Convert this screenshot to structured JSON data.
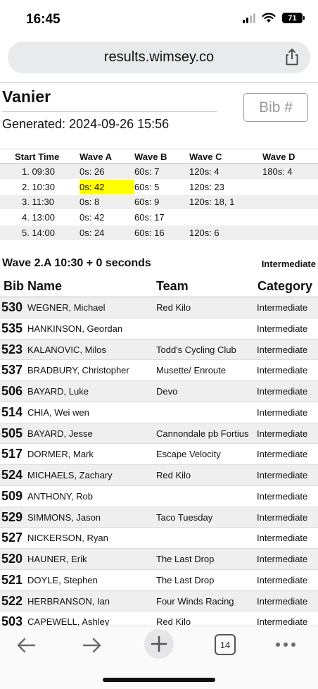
{
  "status_bar": {
    "time": "16:45",
    "battery": "71"
  },
  "browser": {
    "url": "results.wimsey.co",
    "tab_count": "14"
  },
  "page": {
    "title": "Vanier",
    "generated": "Generated: 2024-09-26 15:56",
    "bib_placeholder": "Bib #"
  },
  "wave_table": {
    "headers": [
      "Start Time",
      "Wave A",
      "Wave B",
      "Wave C",
      "Wave D"
    ],
    "rows": [
      [
        "1. 09:30",
        "0s: 26",
        "60s: 7",
        "120s: 4",
        "180s: 4"
      ],
      [
        "2. 10:30",
        "0s: 42",
        "60s: 5",
        "120s: 23",
        ""
      ],
      [
        "3. 11:30",
        "0s: 8",
        "60s: 9",
        "120s: 18, 1",
        ""
      ],
      [
        "4. 13:00",
        "0s: 42",
        "60s: 17",
        "",
        ""
      ],
      [
        "5. 14:00",
        "0s: 24",
        "60s: 16",
        "120s: 6",
        ""
      ]
    ],
    "highlight_color": "#ffff00"
  },
  "wave_section": {
    "heading": "Wave 2.A 10:30 + 0 seconds",
    "category": "Intermediate",
    "headers": {
      "bib": "Bib",
      "name": "Name",
      "team": "Team",
      "category": "Category"
    },
    "riders": [
      {
        "bib": "530",
        "name": "WEGNER, Michael",
        "team": "Red Kilo",
        "category": "Intermediate"
      },
      {
        "bib": "535",
        "name": "HANKINSON, Geordan",
        "team": "",
        "category": "Intermediate"
      },
      {
        "bib": "523",
        "name": "KALANOVIC, Milos",
        "team": "Todd's Cycling Club",
        "category": "Intermediate"
      },
      {
        "bib": "537",
        "name": "BRADBURY, Christopher",
        "team": "Musette/ Enroute",
        "category": "Intermediate"
      },
      {
        "bib": "506",
        "name": "BAYARD, Luke",
        "team": "Devo",
        "category": "Intermediate"
      },
      {
        "bib": "514",
        "name": "CHIA, Wei wen",
        "team": "",
        "category": "Intermediate"
      },
      {
        "bib": "505",
        "name": "BAYARD, Jesse",
        "team": "Cannondale pb Fortius",
        "category": "Intermediate"
      },
      {
        "bib": "517",
        "name": "DORMER, Mark",
        "team": "Escape Velocity",
        "category": "Intermediate"
      },
      {
        "bib": "524",
        "name": "MICHAELS, Zachary",
        "team": "Red Kilo",
        "category": "Intermediate"
      },
      {
        "bib": "509",
        "name": "ANTHONY, Rob",
        "team": "",
        "category": "Intermediate"
      },
      {
        "bib": "529",
        "name": "SIMMONS, Jason",
        "team": "Taco Tuesday",
        "category": "Intermediate"
      },
      {
        "bib": "527",
        "name": "NICKERSON, Ryan",
        "team": "",
        "category": "Intermediate"
      },
      {
        "bib": "520",
        "name": "HAUNER, Erik",
        "team": "The Last Drop",
        "category": "Intermediate"
      },
      {
        "bib": "521",
        "name": "DOYLE, Stephen",
        "team": "The Last Drop",
        "category": "Intermediate"
      },
      {
        "bib": "522",
        "name": "HERBRANSON, Ian",
        "team": "Four Winds Racing",
        "category": "Intermediate"
      },
      {
        "bib": "503",
        "name": "CAPEWELL, Ashley",
        "team": "Red Kilo",
        "category": "Intermediate"
      }
    ]
  }
}
